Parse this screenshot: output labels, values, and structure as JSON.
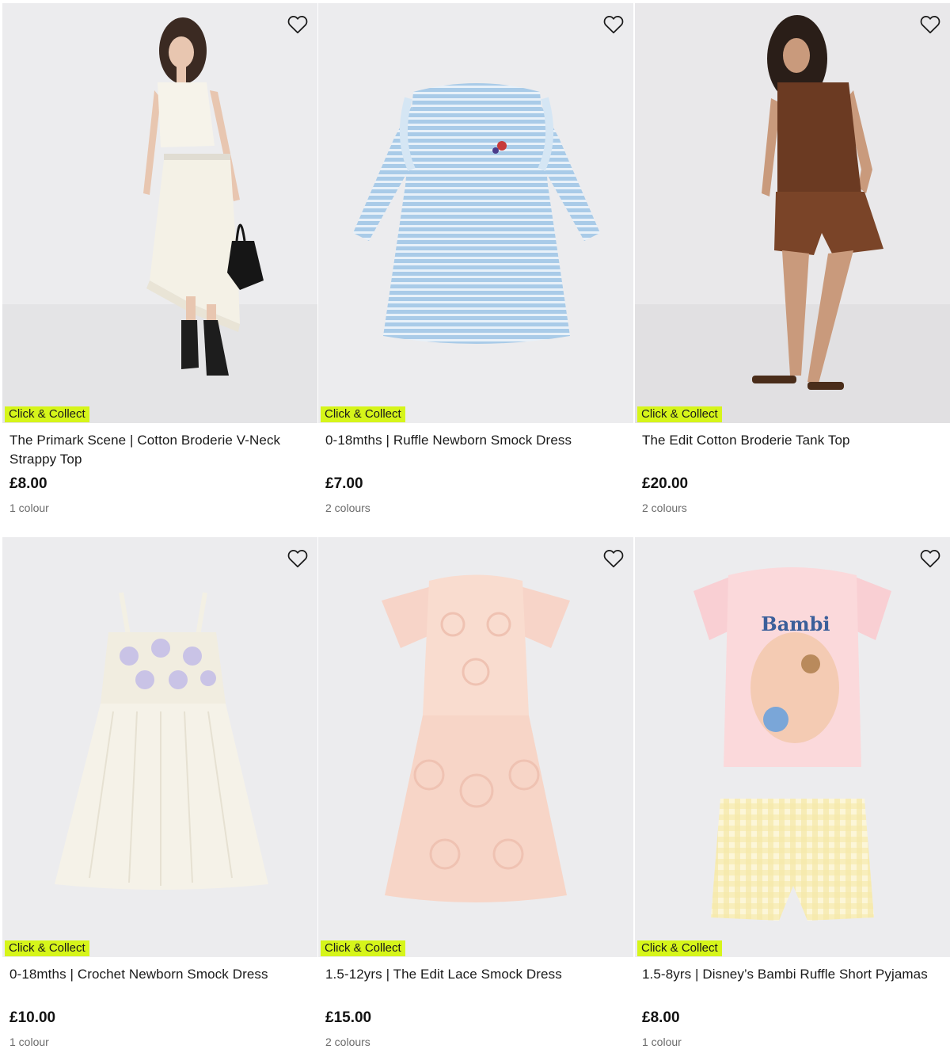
{
  "products": [
    {
      "badge": "Click & Collect",
      "title": "The Primark Scene | Cotton Broderie V-Neck Strappy Top",
      "price": "£8.00",
      "colours": "1 colour",
      "image": "woman-white-lace-outfit",
      "wishlist_icon": "heart-outline-icon"
    },
    {
      "badge": "Click & Collect",
      "title": "0-18mths | Ruffle Newborn Smock Dress",
      "price": "£7.00",
      "colours": "2 colours",
      "image": "blue-striped-baby-dress",
      "wishlist_icon": "heart-outline-icon"
    },
    {
      "badge": "Click & Collect",
      "title": "The Edit Cotton Broderie Tank Top",
      "price": "£20.00",
      "colours": "2 colours",
      "image": "woman-brown-tank-and-shorts",
      "wishlist_icon": "heart-outline-icon"
    },
    {
      "badge": "Click & Collect",
      "title": "0-18mths | Crochet Newborn Smock Dress",
      "price": "£10.00",
      "colours": "1 colour",
      "image": "white-crochet-baby-dress",
      "wishlist_icon": "heart-outline-icon"
    },
    {
      "badge": "Click & Collect",
      "title": "1.5-12yrs | The Edit Lace Smock Dress",
      "price": "£15.00",
      "colours": "2 colours",
      "image": "pink-lace-girls-dress",
      "wishlist_icon": "heart-outline-icon"
    },
    {
      "badge": "Click & Collect",
      "title": "1.5-8yrs | Disney’s Bambi Ruffle Short Pyjamas",
      "price": "£8.00",
      "colours": "1 colour",
      "image": "bambi-pink-pyjama-set",
      "image_text": "Bambi",
      "wishlist_icon": "heart-outline-icon"
    }
  ],
  "colors": {
    "badge_bg": "#d6f51a",
    "image_bg": "#ebebec",
    "price_text": "#111111",
    "muted_text": "#6b6b6b"
  }
}
